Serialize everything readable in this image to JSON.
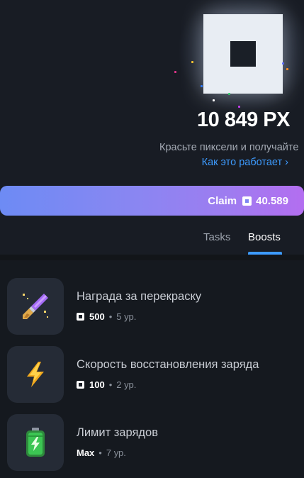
{
  "header": {
    "balance": "10 849 PX",
    "subtitle": "Красьте пиксели и получайте",
    "how_link": "Как это работает ›"
  },
  "claim": {
    "label": "Claim",
    "amount": "40.589",
    "icon": "pixel-coin-icon"
  },
  "tabs": [
    {
      "label": "Tasks",
      "active": false
    },
    {
      "label": "Boosts",
      "active": true
    }
  ],
  "boosts": [
    {
      "title": "Награда за перекраску",
      "price": "500",
      "level": "5 ур.",
      "icon": "brush-icon"
    },
    {
      "title": "Скорость восстановления заряда",
      "price": "100",
      "level": "2 ур.",
      "icon": "lightning-icon"
    },
    {
      "title": "Лимит зарядов",
      "price": "Max",
      "level": "7 ур.",
      "icon": "battery-icon"
    }
  ],
  "colors": {
    "background": "#15191f",
    "accent": "#3d9bff",
    "claim_gradient_start": "#6d8bf4",
    "claim_gradient_end": "#b36ef0"
  }
}
